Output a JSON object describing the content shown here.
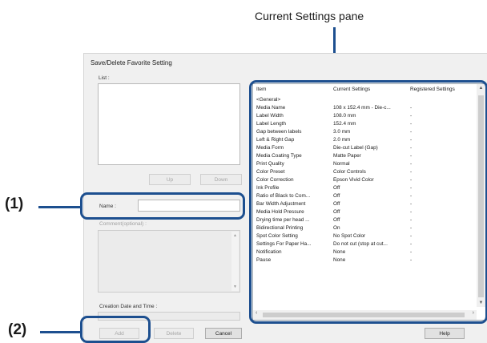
{
  "callout_title": "Current Settings pane",
  "callout_1": "(1)",
  "callout_2": "(2)",
  "dialog": {
    "title": "Save/Delete Favorite Setting",
    "list_label": "List :",
    "up_button": "Up",
    "down_button": "Down",
    "name_label": "Name :",
    "name_value": "",
    "comment_label": "Comment(optional) :",
    "creation_label": "Creation Date and Time :",
    "creation_value": "",
    "add_button": "Add",
    "delete_button": "Delete",
    "cancel_button": "Cancel",
    "help_button": "Help"
  },
  "settings_table": {
    "headers": [
      "Item",
      "Current Settings",
      "Registered Settings"
    ],
    "rows": [
      [
        "<General>",
        "",
        ""
      ],
      [
        "Media Name",
        "108 x 152.4 mm - Die-c...",
        "-"
      ],
      [
        "Label Width",
        "108.0 mm",
        "-"
      ],
      [
        "Label Length",
        "152.4 mm",
        "-"
      ],
      [
        "Gap between labels",
        "3.0 mm",
        "-"
      ],
      [
        "Left & Right Gap",
        "2.0 mm",
        "-"
      ],
      [
        "Media Form",
        "Die-cut Label (Gap)",
        "-"
      ],
      [
        "Media Coating Type",
        "Matte Paper",
        "-"
      ],
      [
        "Print Quality",
        "Normal",
        "-"
      ],
      [
        "Color Preset",
        "Color Controls",
        "-"
      ],
      [
        "Color Correction",
        "Epson Vivid Color",
        "-"
      ],
      [
        "Ink Profile",
        "Off",
        "-"
      ],
      [
        "Ratio of Black to Com...",
        "Off",
        "-"
      ],
      [
        "Bar Width Adjustment",
        "Off",
        "-"
      ],
      [
        "Media Hold Pressure",
        "Off",
        "-"
      ],
      [
        "Drying time per head ...",
        "Off",
        "-"
      ],
      [
        "Bidirectional Printing",
        "On",
        "-"
      ],
      [
        "Spot Color Setting",
        "No Spot Color",
        "-"
      ],
      [
        "Settings For Paper Ha...",
        "Do not cut (stop at cut...",
        "-"
      ],
      [
        "Notification",
        "None",
        "-"
      ],
      [
        "Pause",
        "None",
        "-"
      ]
    ]
  },
  "colors": {
    "accent": "#1d4f8f"
  }
}
